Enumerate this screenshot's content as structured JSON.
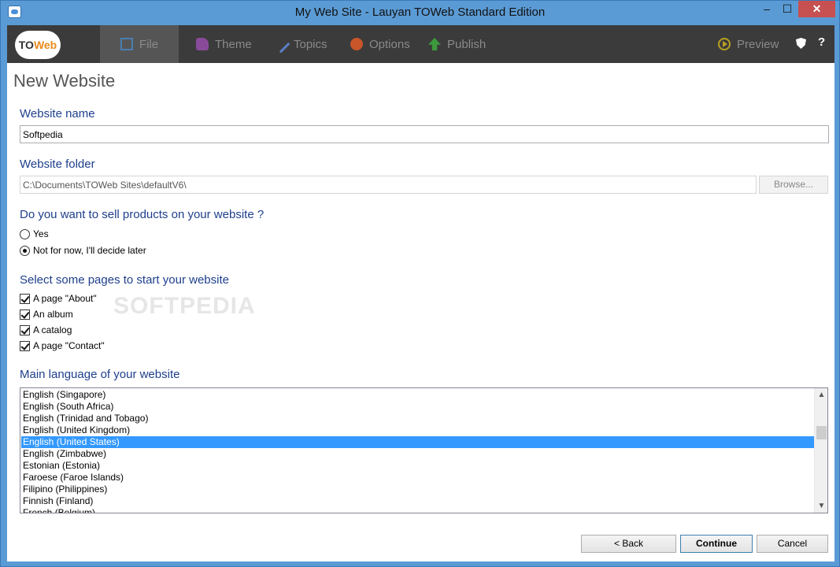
{
  "window": {
    "title": "My Web Site - Lauyan TOWeb Standard Edition",
    "minimize": "–",
    "maximize": "☐",
    "close": "✕"
  },
  "toolbar": {
    "logo_to": "TO",
    "logo_web": "Web",
    "tabs": [
      {
        "label": "File",
        "icon": "folder-icon"
      },
      {
        "label": "Theme",
        "icon": "paint-bucket-icon"
      },
      {
        "label": "Topics",
        "icon": "pencil-icon"
      },
      {
        "label": "Options",
        "icon": "gears-icon"
      },
      {
        "label": "Publish",
        "icon": "upload-arrow-icon"
      }
    ],
    "preview": "Preview",
    "help": "?"
  },
  "page": {
    "title": "New Website"
  },
  "form": {
    "name_label": "Website name",
    "name_value": "Softpedia",
    "folder_label": "Website folder",
    "folder_value": "C:\\Documents\\TOWeb Sites\\defaultV6\\",
    "browse": "Browse...",
    "sell_label": "Do you want to sell products on your website ?",
    "sell_options": [
      {
        "label": "Yes",
        "checked": false
      },
      {
        "label": "Not for now, I'll decide later",
        "checked": true
      }
    ],
    "pages_label": "Select some pages to start your website",
    "pages": [
      {
        "label": "A page \"About\"",
        "checked": true
      },
      {
        "label": "An album",
        "checked": true
      },
      {
        "label": "A catalog",
        "checked": true
      },
      {
        "label": "A page \"Contact\"",
        "checked": true
      }
    ],
    "language_label": "Main language of your website",
    "languages": [
      "English (Singapore)",
      "English (South Africa)",
      "English (Trinidad and Tobago)",
      "English (United Kingdom)",
      "English (United States)",
      "English (Zimbabwe)",
      "Estonian (Estonia)",
      "Faroese (Faroe Islands)",
      "Filipino (Philippines)",
      "Finnish (Finland)",
      "French (Belgium)"
    ],
    "selected_language": "English (United States)"
  },
  "watermark": "SOFTPEDIA",
  "footer": {
    "back": "< Back",
    "continue": "Continue",
    "cancel": "Cancel"
  }
}
